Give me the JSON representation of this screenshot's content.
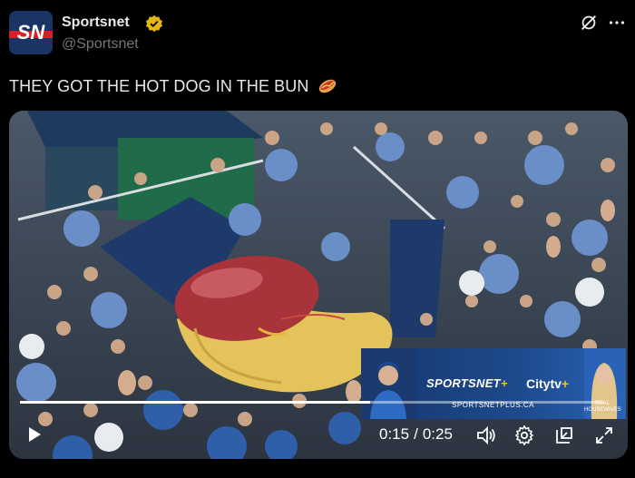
{
  "author": {
    "name": "Sportsnet",
    "handle": "@Sportsnet",
    "logo_text": "SN"
  },
  "tweet": {
    "text": "THEY GOT THE HOT DOG IN THE BUN",
    "emoji_icon": "hot-dog-icon"
  },
  "video": {
    "current_time": "0:15",
    "separator": "/",
    "duration": "0:25",
    "progress": 0.6
  },
  "banner": {
    "sportsnet": "SPORTSNET",
    "plus": "+",
    "citytv": "Citytv",
    "citytv_plus": "+",
    "url": "SPORTSNETPLUS.CA",
    "show_line1": "REAL",
    "show_line2": "HOUSEWIVES"
  },
  "colors": {
    "background": "#000000",
    "text": "#e7e9ea",
    "secondary_text": "#71767b",
    "verified_gold": "#e2b719"
  }
}
